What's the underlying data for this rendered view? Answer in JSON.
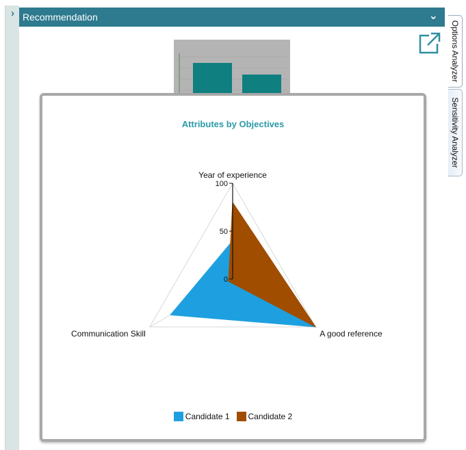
{
  "panel": {
    "title": "Recommendation"
  },
  "side_tabs": {
    "options_analyzer": "Options Analyzer",
    "sensitivity_analyzer": "Sensitivity Analyzer"
  },
  "chart_data": {
    "type": "radar",
    "title": "Attributes by Objectives",
    "axes": [
      "Year of experience",
      "A good reference",
      "Communication Skill"
    ],
    "radial_ticks": [
      0,
      50,
      100
    ],
    "range": [
      0,
      100
    ],
    "series": [
      {
        "name": "Candidate 1",
        "color": "#1ea0e0",
        "values": [
          40,
          100,
          75
        ]
      },
      {
        "name": "Candidate 2",
        "color": "#a04d00",
        "values": [
          80,
          100,
          5
        ]
      }
    ],
    "legend_position": "bottom"
  },
  "colors": {
    "header": "#2e7a8f",
    "title": "#2b9aa8",
    "thumbnail_bar": "#0f7f7f"
  }
}
